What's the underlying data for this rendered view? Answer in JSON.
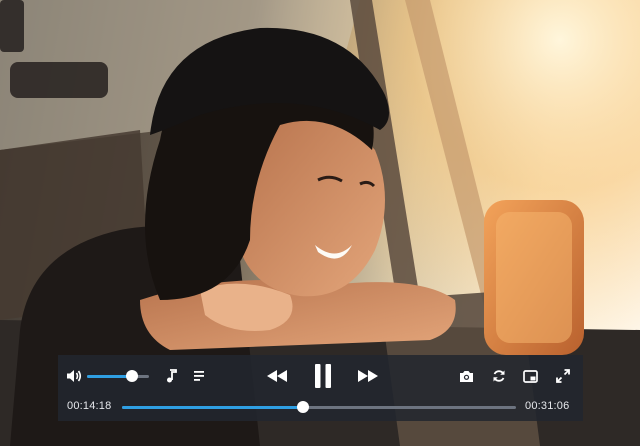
{
  "player": {
    "current_time": "00:14:18",
    "total_time": "00:31:06",
    "progress": 0.46,
    "volume": 0.72,
    "state": "playing",
    "accent_color": "#2f9fe3"
  },
  "icons": {
    "volume": "speaker-icon",
    "audio_track": "music-note-icon",
    "playlist": "list-icon",
    "rewind": "rewind-icon",
    "pause": "pause-icon",
    "fast_forward": "fast-forward-icon",
    "screenshot": "camera-icon",
    "loop": "loop-icon",
    "mini_player": "picture-in-picture-icon",
    "fullscreen": "fullscreen-icon"
  }
}
